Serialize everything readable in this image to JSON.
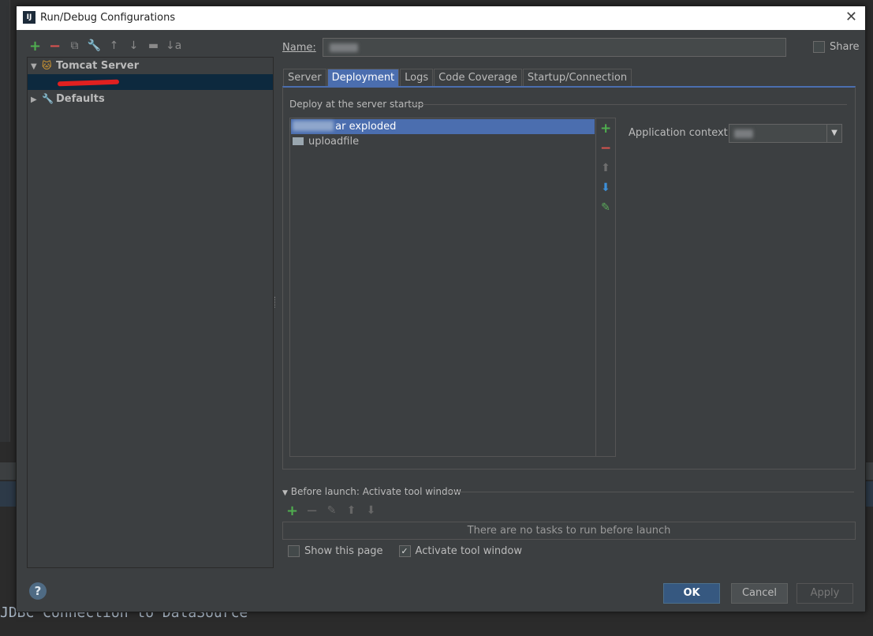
{
  "dialog": {
    "title": "Run/Debug Configurations",
    "app_icon": "IJ"
  },
  "background": {
    "code_line": "JDBC Connection to DataSource"
  },
  "left_panel": {
    "toolbar": [
      "+",
      "−",
      "⧉",
      "🔧",
      "↑",
      "↓",
      "▬",
      "↓a"
    ],
    "tree": [
      {
        "label": "Tomcat Server",
        "expanded": true
      },
      {
        "label": "Defaults",
        "expanded": false
      }
    ]
  },
  "name": {
    "label": "Name:",
    "value": ""
  },
  "share": {
    "label": "Share",
    "checked": false
  },
  "tabs": [
    "Server",
    "Deployment",
    "Logs",
    "Code Coverage",
    "Startup/Connection"
  ],
  "active_tab": "Deployment",
  "deployment": {
    "group_title": "Deploy at the server startup",
    "items": [
      {
        "label": "ar exploded",
        "selected": true
      },
      {
        "label": "uploadfile",
        "selected": false
      }
    ],
    "app_context_label": "Application context:",
    "app_context_value": ""
  },
  "before_launch": {
    "title": "Before launch: Activate tool window",
    "empty_text": "There are no tasks to run before launch"
  },
  "options": {
    "show_this_page": {
      "label": "Show this page",
      "checked": false
    },
    "activate_tool_window": {
      "label": "Activate tool window",
      "checked": true
    }
  },
  "buttons": {
    "help": "?",
    "ok": "OK",
    "cancel": "Cancel",
    "apply": "Apply"
  },
  "colors": {
    "accent": "#4b6eaf",
    "ok_button": "#365880",
    "add_green": "#4fae4f",
    "remove_red": "#d9534f"
  }
}
